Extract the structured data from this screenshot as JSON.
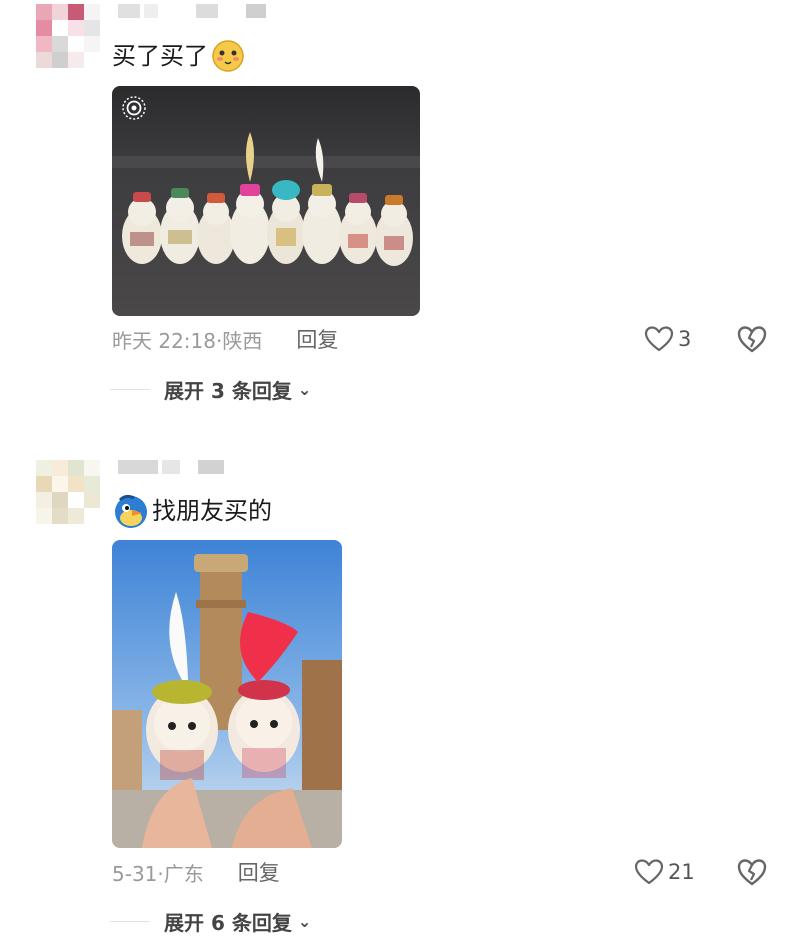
{
  "comments": [
    {
      "text": "买了买了",
      "time": "昨天 22:18·陕西",
      "reply_label": "回复",
      "likes": "3",
      "expand_label": "展开 3 条回复",
      "emoji_icon": "blush-face-emoji-icon",
      "avatar_colors": [
        "#e9a6b6",
        "#f2d3d9",
        "#c85a76",
        "#f4f4f4",
        "#e58ca4",
        "#ffffff",
        "#f7e0e6",
        "#e5e5e5",
        "#f0b7c5",
        "#d9d9d9",
        "#ffffff",
        "#f5f5f5",
        "#eadada",
        "#cfcfcf",
        "#f6eaea",
        "#ffffff"
      ]
    },
    {
      "text": "找朋友买的",
      "time": "5-31·广东",
      "reply_label": "回复",
      "likes": "21",
      "expand_label": "展开 6 条回复",
      "emoji_icon": "blue-bird-emoji-icon",
      "avatar_colors": [
        "#eef0e2",
        "#f6ecd8",
        "#e1e5cf",
        "#f7f7f0",
        "#e7d8b8",
        "#fbf5ea",
        "#f1e3c6",
        "#e8ead8",
        "#f4efe3",
        "#dfd7c2",
        "#ffffff",
        "#ece8d5",
        "#f7f4ea",
        "#e3ddc8",
        "#eeeada",
        "#ffffff"
      ]
    }
  ],
  "colors": {
    "accent_heart": "#777777",
    "muted_text": "#9a9a9a"
  }
}
